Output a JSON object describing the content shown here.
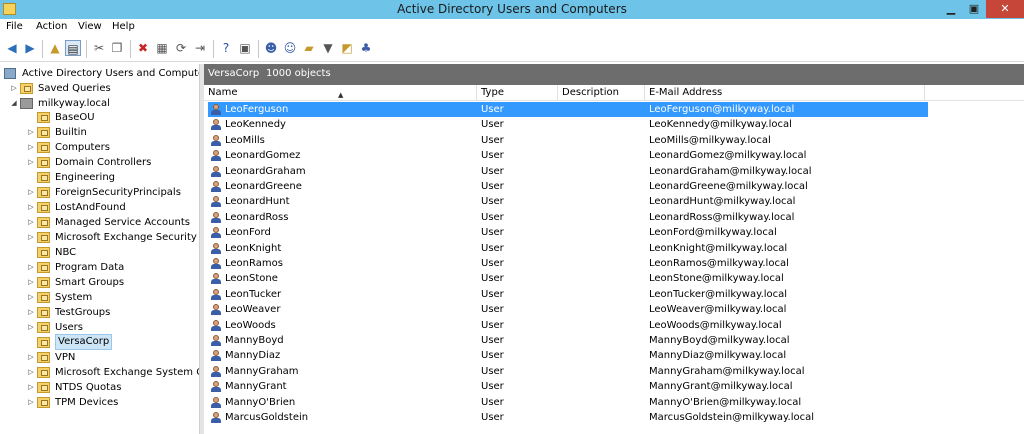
{
  "window": {
    "title": "Active Directory Users and Computers",
    "min_glyph": "▁",
    "max_glyph": "▣",
    "close_glyph": "✕"
  },
  "menu": [
    "File",
    "Action",
    "View",
    "Help"
  ],
  "tree": {
    "root": "Active Directory Users and Computers [D",
    "saved_queries": "Saved Queries",
    "domain": "milkyway.local",
    "items": [
      "BaseOU",
      "Builtin",
      "Computers",
      "Domain Controllers",
      "Engineering",
      "ForeignSecurityPrincipals",
      "LostAndFound",
      "Managed Service Accounts",
      "Microsoft Exchange Security Grou",
      "NBC",
      "Program Data",
      "Smart Groups",
      "System",
      "TestGroups",
      "Users",
      "VersaCorp",
      "VPN",
      "Microsoft Exchange System Obje",
      "NTDS Quotas",
      "TPM Devices"
    ],
    "selected": "VersaCorp"
  },
  "content": {
    "container": "VersaCorp",
    "count": "1000 objects"
  },
  "columns": {
    "name": "Name",
    "type": "Type",
    "description": "Description",
    "email": "E-Mail Address"
  },
  "rows": [
    {
      "name": "LeoFerguson",
      "type": "User",
      "email": "LeoFerguson@milkyway.local"
    },
    {
      "name": "LeoKennedy",
      "type": "User",
      "email": "LeoKennedy@milkyway.local"
    },
    {
      "name": "LeoMills",
      "type": "User",
      "email": "LeoMills@milkyway.local"
    },
    {
      "name": "LeonardGomez",
      "type": "User",
      "email": "LeonardGomez@milkyway.local"
    },
    {
      "name": "LeonardGraham",
      "type": "User",
      "email": "LeonardGraham@milkyway.local"
    },
    {
      "name": "LeonardGreene",
      "type": "User",
      "email": "LeonardGreene@milkyway.local"
    },
    {
      "name": "LeonardHunt",
      "type": "User",
      "email": "LeonardHunt@milkyway.local"
    },
    {
      "name": "LeonardRoss",
      "type": "User",
      "email": "LeonardRoss@milkyway.local"
    },
    {
      "name": "LeonFord",
      "type": "User",
      "email": "LeonFord@milkyway.local"
    },
    {
      "name": "LeonKnight",
      "type": "User",
      "email": "LeonKnight@milkyway.local"
    },
    {
      "name": "LeonRamos",
      "type": "User",
      "email": "LeonRamos@milkyway.local"
    },
    {
      "name": "LeonStone",
      "type": "User",
      "email": "LeonStone@milkyway.local"
    },
    {
      "name": "LeonTucker",
      "type": "User",
      "email": "LeonTucker@milkyway.local"
    },
    {
      "name": "LeoWeaver",
      "type": "User",
      "email": "LeoWeaver@milkyway.local"
    },
    {
      "name": "LeoWoods",
      "type": "User",
      "email": "LeoWoods@milkyway.local"
    },
    {
      "name": "MannyBoyd",
      "type": "User",
      "email": "MannyBoyd@milkyway.local"
    },
    {
      "name": "MannyDiaz",
      "type": "User",
      "email": "MannyDiaz@milkyway.local"
    },
    {
      "name": "MannyGraham",
      "type": "User",
      "email": "MannyGraham@milkyway.local"
    },
    {
      "name": "MannyGrant",
      "type": "User",
      "email": "MannyGrant@milkyway.local"
    },
    {
      "name": "MannyO'Brien",
      "type": "User",
      "email": "MannyO'Brien@milkyway.local"
    },
    {
      "name": "MarcusGoldstein",
      "type": "User",
      "email": "MarcusGoldstein@milkyway.local"
    }
  ],
  "selected_row": "LeoFerguson",
  "toolbar_icons": [
    "back-icon",
    "forward-icon",
    "up-folder-icon",
    "show-console-tree-icon",
    "cut-icon",
    "copy-icon",
    "delete-icon",
    "properties-icon",
    "refresh-icon",
    "export-list-icon",
    "help-icon",
    "console-help-icon",
    "new-user-icon",
    "new-group-icon",
    "new-ou-icon",
    "filter-icon",
    "find-icon",
    "add-to-group-icon"
  ],
  "colors": {
    "titlebar": "#6ec4e8",
    "selection": "#3399ff",
    "header_band": "#6d6d6d",
    "close_button": "#c7463a"
  }
}
